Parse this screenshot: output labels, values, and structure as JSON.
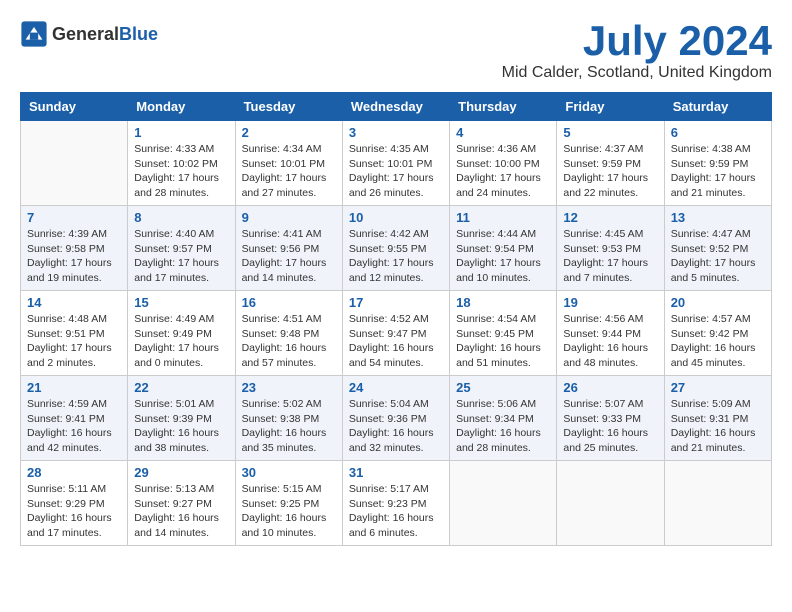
{
  "header": {
    "logo_general": "General",
    "logo_blue": "Blue",
    "month_year": "July 2024",
    "location": "Mid Calder, Scotland, United Kingdom"
  },
  "weekdays": [
    "Sunday",
    "Monday",
    "Tuesday",
    "Wednesday",
    "Thursday",
    "Friday",
    "Saturday"
  ],
  "weeks": [
    [
      {
        "day": "",
        "sunrise": "",
        "sunset": "",
        "daylight": ""
      },
      {
        "day": "1",
        "sunrise": "Sunrise: 4:33 AM",
        "sunset": "Sunset: 10:02 PM",
        "daylight": "Daylight: 17 hours and 28 minutes."
      },
      {
        "day": "2",
        "sunrise": "Sunrise: 4:34 AM",
        "sunset": "Sunset: 10:01 PM",
        "daylight": "Daylight: 17 hours and 27 minutes."
      },
      {
        "day": "3",
        "sunrise": "Sunrise: 4:35 AM",
        "sunset": "Sunset: 10:01 PM",
        "daylight": "Daylight: 17 hours and 26 minutes."
      },
      {
        "day": "4",
        "sunrise": "Sunrise: 4:36 AM",
        "sunset": "Sunset: 10:00 PM",
        "daylight": "Daylight: 17 hours and 24 minutes."
      },
      {
        "day": "5",
        "sunrise": "Sunrise: 4:37 AM",
        "sunset": "Sunset: 9:59 PM",
        "daylight": "Daylight: 17 hours and 22 minutes."
      },
      {
        "day": "6",
        "sunrise": "Sunrise: 4:38 AM",
        "sunset": "Sunset: 9:59 PM",
        "daylight": "Daylight: 17 hours and 21 minutes."
      }
    ],
    [
      {
        "day": "7",
        "sunrise": "Sunrise: 4:39 AM",
        "sunset": "Sunset: 9:58 PM",
        "daylight": "Daylight: 17 hours and 19 minutes."
      },
      {
        "day": "8",
        "sunrise": "Sunrise: 4:40 AM",
        "sunset": "Sunset: 9:57 PM",
        "daylight": "Daylight: 17 hours and 17 minutes."
      },
      {
        "day": "9",
        "sunrise": "Sunrise: 4:41 AM",
        "sunset": "Sunset: 9:56 PM",
        "daylight": "Daylight: 17 hours and 14 minutes."
      },
      {
        "day": "10",
        "sunrise": "Sunrise: 4:42 AM",
        "sunset": "Sunset: 9:55 PM",
        "daylight": "Daylight: 17 hours and 12 minutes."
      },
      {
        "day": "11",
        "sunrise": "Sunrise: 4:44 AM",
        "sunset": "Sunset: 9:54 PM",
        "daylight": "Daylight: 17 hours and 10 minutes."
      },
      {
        "day": "12",
        "sunrise": "Sunrise: 4:45 AM",
        "sunset": "Sunset: 9:53 PM",
        "daylight": "Daylight: 17 hours and 7 minutes."
      },
      {
        "day": "13",
        "sunrise": "Sunrise: 4:47 AM",
        "sunset": "Sunset: 9:52 PM",
        "daylight": "Daylight: 17 hours and 5 minutes."
      }
    ],
    [
      {
        "day": "14",
        "sunrise": "Sunrise: 4:48 AM",
        "sunset": "Sunset: 9:51 PM",
        "daylight": "Daylight: 17 hours and 2 minutes."
      },
      {
        "day": "15",
        "sunrise": "Sunrise: 4:49 AM",
        "sunset": "Sunset: 9:49 PM",
        "daylight": "Daylight: 17 hours and 0 minutes."
      },
      {
        "day": "16",
        "sunrise": "Sunrise: 4:51 AM",
        "sunset": "Sunset: 9:48 PM",
        "daylight": "Daylight: 16 hours and 57 minutes."
      },
      {
        "day": "17",
        "sunrise": "Sunrise: 4:52 AM",
        "sunset": "Sunset: 9:47 PM",
        "daylight": "Daylight: 16 hours and 54 minutes."
      },
      {
        "day": "18",
        "sunrise": "Sunrise: 4:54 AM",
        "sunset": "Sunset: 9:45 PM",
        "daylight": "Daylight: 16 hours and 51 minutes."
      },
      {
        "day": "19",
        "sunrise": "Sunrise: 4:56 AM",
        "sunset": "Sunset: 9:44 PM",
        "daylight": "Daylight: 16 hours and 48 minutes."
      },
      {
        "day": "20",
        "sunrise": "Sunrise: 4:57 AM",
        "sunset": "Sunset: 9:42 PM",
        "daylight": "Daylight: 16 hours and 45 minutes."
      }
    ],
    [
      {
        "day": "21",
        "sunrise": "Sunrise: 4:59 AM",
        "sunset": "Sunset: 9:41 PM",
        "daylight": "Daylight: 16 hours and 42 minutes."
      },
      {
        "day": "22",
        "sunrise": "Sunrise: 5:01 AM",
        "sunset": "Sunset: 9:39 PM",
        "daylight": "Daylight: 16 hours and 38 minutes."
      },
      {
        "day": "23",
        "sunrise": "Sunrise: 5:02 AM",
        "sunset": "Sunset: 9:38 PM",
        "daylight": "Daylight: 16 hours and 35 minutes."
      },
      {
        "day": "24",
        "sunrise": "Sunrise: 5:04 AM",
        "sunset": "Sunset: 9:36 PM",
        "daylight": "Daylight: 16 hours and 32 minutes."
      },
      {
        "day": "25",
        "sunrise": "Sunrise: 5:06 AM",
        "sunset": "Sunset: 9:34 PM",
        "daylight": "Daylight: 16 hours and 28 minutes."
      },
      {
        "day": "26",
        "sunrise": "Sunrise: 5:07 AM",
        "sunset": "Sunset: 9:33 PM",
        "daylight": "Daylight: 16 hours and 25 minutes."
      },
      {
        "day": "27",
        "sunrise": "Sunrise: 5:09 AM",
        "sunset": "Sunset: 9:31 PM",
        "daylight": "Daylight: 16 hours and 21 minutes."
      }
    ],
    [
      {
        "day": "28",
        "sunrise": "Sunrise: 5:11 AM",
        "sunset": "Sunset: 9:29 PM",
        "daylight": "Daylight: 16 hours and 17 minutes."
      },
      {
        "day": "29",
        "sunrise": "Sunrise: 5:13 AM",
        "sunset": "Sunset: 9:27 PM",
        "daylight": "Daylight: 16 hours and 14 minutes."
      },
      {
        "day": "30",
        "sunrise": "Sunrise: 5:15 AM",
        "sunset": "Sunset: 9:25 PM",
        "daylight": "Daylight: 16 hours and 10 minutes."
      },
      {
        "day": "31",
        "sunrise": "Sunrise: 5:17 AM",
        "sunset": "Sunset: 9:23 PM",
        "daylight": "Daylight: 16 hours and 6 minutes."
      },
      {
        "day": "",
        "sunrise": "",
        "sunset": "",
        "daylight": ""
      },
      {
        "day": "",
        "sunrise": "",
        "sunset": "",
        "daylight": ""
      },
      {
        "day": "",
        "sunrise": "",
        "sunset": "",
        "daylight": ""
      }
    ]
  ]
}
